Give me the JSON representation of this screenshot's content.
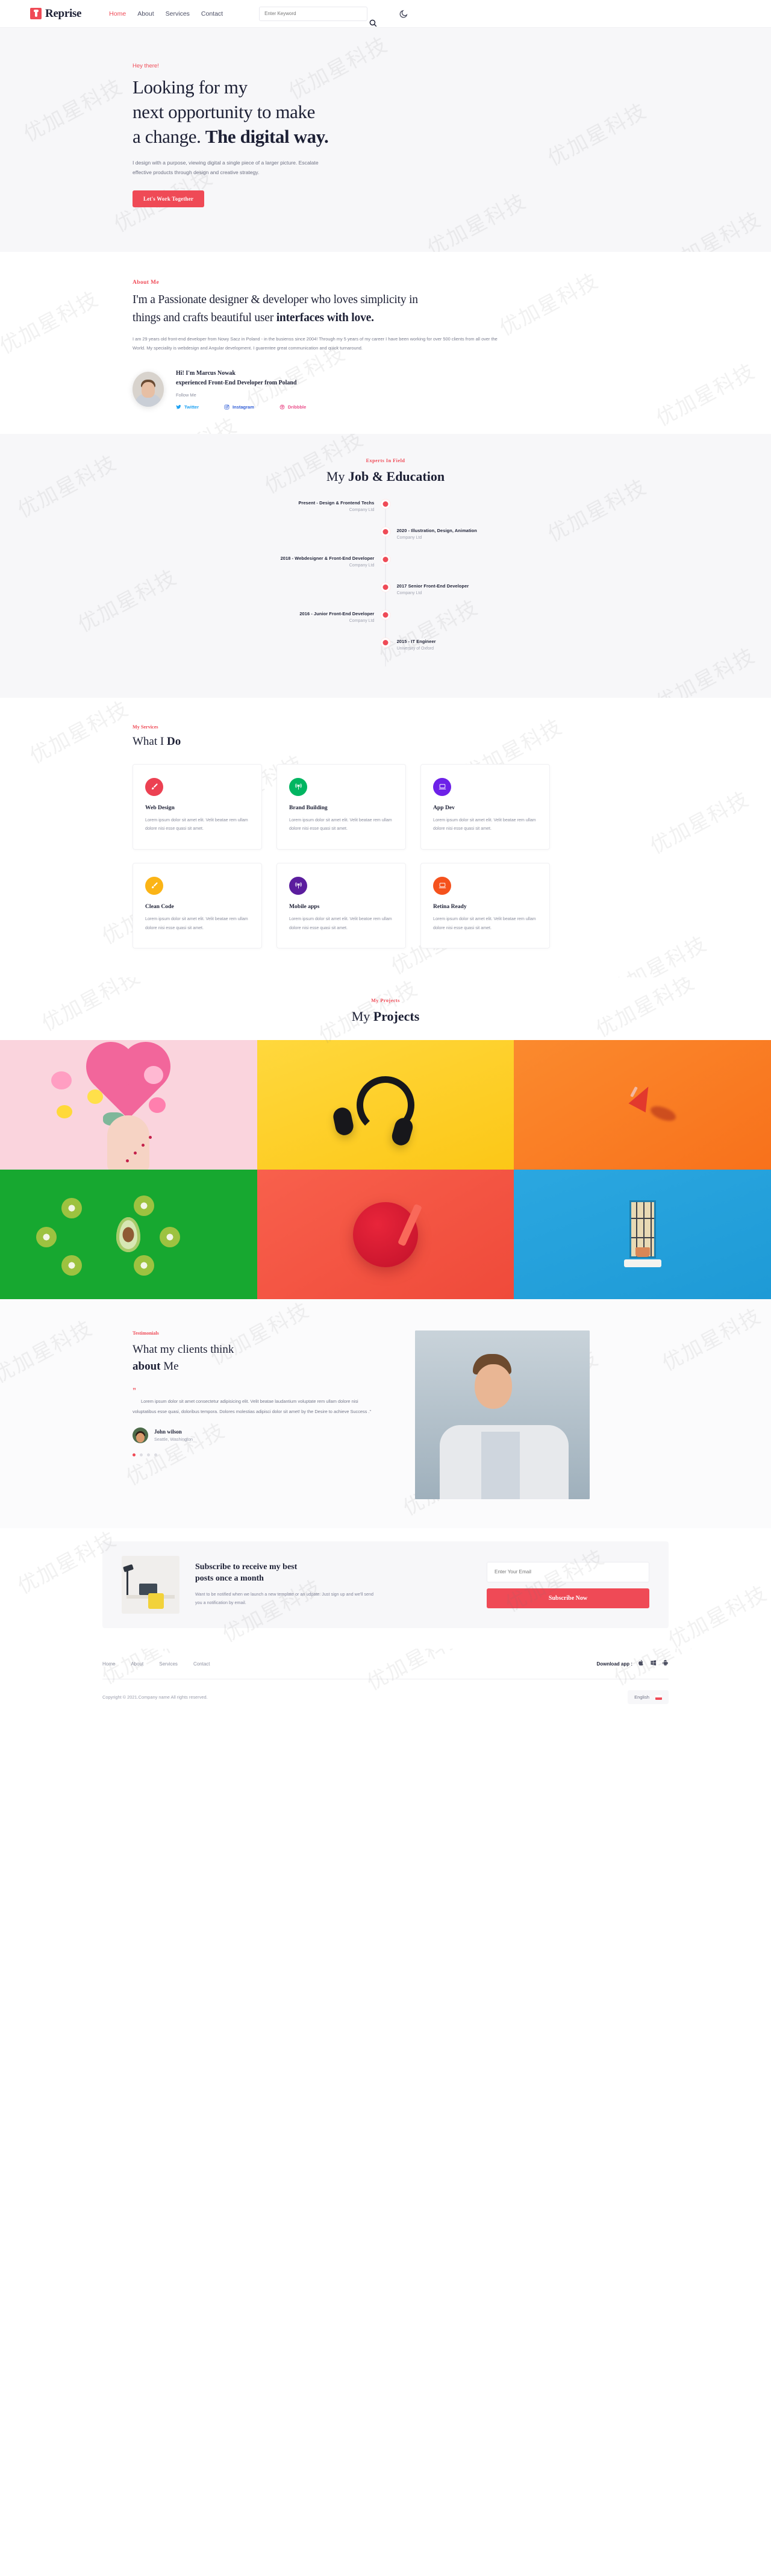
{
  "header": {
    "brand": "Reprise",
    "nav": [
      {
        "label": "Home",
        "active": true
      },
      {
        "label": "About",
        "active": false
      },
      {
        "label": "Services",
        "active": false
      },
      {
        "label": "Contact",
        "active": false
      }
    ],
    "search_placeholder": "Enter Keyword",
    "search_icon": "search-icon",
    "theme_icon": "moon-icon"
  },
  "hero": {
    "eyebrow": "Hey there!",
    "title_line1": "Looking for my",
    "title_line2": "next opportunity to make",
    "title_line3_normal": "a change. ",
    "title_line3_bold": "The digital way.",
    "description": "I design with a purpose, viewing digital a single piece of a larger picture. Escalate effective products through design and creative strategy.",
    "cta_label": "Let's Work Together"
  },
  "about": {
    "eyebrow": "About Me",
    "title_normal": "I'm a Passionate designer & developer who loves simplicity in things and crafts beautiful user ",
    "title_bold": "interfaces with love.",
    "description": "I am 29 years old front-end developer from Nowy Sacz in Poland - in the busienss since 2004! Through my 5 years of my career I have been working for over 500 clients from all over the World. My speciality is webdesign and Angular development. I guarentee great communication and quick turnaround.",
    "person_name_line1": "Hi! I'm Marcus Nowak",
    "person_name_line2": "experienced Front-End Developer from Poland",
    "follow_label": "Follow Me",
    "socials": [
      {
        "label": "Twitter",
        "icon": "twitter-icon",
        "color": "#1da1f2"
      },
      {
        "label": "Instagram",
        "icon": "instagram-icon",
        "color": "#2f5cd6"
      },
      {
        "label": "Dribbble",
        "icon": "dribbble-icon",
        "color": "#ea4c89"
      }
    ]
  },
  "resume": {
    "eyebrow": "Experts In Field",
    "title_normal": "My ",
    "title_bold": "Job & Education",
    "items": [
      {
        "side": "left",
        "role": "Present - Design & Frontend Techs",
        "org": "Company Ltd"
      },
      {
        "side": "right",
        "role": "2020 - Illustration, Design, Animation",
        "org": "Company Ltd"
      },
      {
        "side": "left",
        "role": "2018 - Webdesigner & Front-End Developer",
        "org": "Company Ltd"
      },
      {
        "side": "right",
        "role": "2017 Senior Front-End Developer",
        "org": "Company Ltd"
      },
      {
        "side": "left",
        "role": "2016 - Junior Front-End Developer",
        "org": "Company Ltd"
      },
      {
        "side": "right",
        "role": "2015 - IT Engineer",
        "org": "University of Oxford"
      }
    ]
  },
  "services": {
    "eyebrow": "My Services",
    "title_normal": "What I ",
    "title_bold": "Do",
    "cards": [
      {
        "title": "Web Design",
        "icon": "brush-icon",
        "color": "#ec4152",
        "text": "Lorem ipsum dolor sit amet elit. Velit beatae rem ullam dolore nisi esse quasi sit amet."
      },
      {
        "title": "Brand Building",
        "icon": "broadcast-icon",
        "color": "#00b561",
        "text": "Lorem ipsum dolor sit amet elit. Velit beatae rem ullam dolore nisi esse quasi sit amet."
      },
      {
        "title": "App Dev",
        "icon": "laptop-icon",
        "color": "#6d21e8",
        "text": "Lorem ipsum dolor sit amet elit. Velit beatae rem ullam dolore nisi esse quasi sit amet."
      },
      {
        "title": "Clean Code",
        "icon": "brush-icon",
        "color": "#fbb416",
        "text": "Lorem ipsum dolor sit amet elit. Velit beatae rem ullam dolore nisi esse quasi sit amet."
      },
      {
        "title": "Mobile apps",
        "icon": "broadcast-icon",
        "color": "#5b1d9e",
        "text": "Lorem ipsum dolor sit amet elit. Velit beatoe rem ullam dolore nisi esse quasi sit amet."
      },
      {
        "title": "Retina Ready",
        "icon": "laptop-icon",
        "color": "#f5521d",
        "text": "Lorem ipsum dolor sit amet elit. Velit beatae rem ullam dolore nisi esse quasi sit amet."
      }
    ]
  },
  "projects": {
    "eyebrow": "My Projects",
    "title_normal": "My ",
    "title_bold": "Projects",
    "tiles": [
      {
        "name": "flowers-heart-in-hands",
        "bg": "#fad4dd"
      },
      {
        "name": "black-headphones",
        "bg": "#ffd83d"
      },
      {
        "name": "red-megaphone",
        "bg": "#f8711b"
      },
      {
        "name": "kiwi-avocado-flatlay",
        "bg": "#17a830"
      },
      {
        "name": "red-smoothie-bowl",
        "bg": "#f8604c"
      },
      {
        "name": "blue-wall-window",
        "bg": "#2ba7e0"
      }
    ]
  },
  "testimonials": {
    "eyebrow": "Testimonials",
    "title_line1": "What my clients think",
    "title_bold": "about",
    "title_tail": " Me",
    "quote_mark": "”",
    "quote": "Lorem ipsum dolor sit amet consectetur adipisicing elit. Velit beatae laudantium voluptate rem ullam dolore nisi voluptatibus esse quasi, doloribus tempora. Dolores molestias adipisci dolor sit amet! by the Desire to achieve Success .\"",
    "author_name": "John wilson",
    "author_location": "Seattle, Washington",
    "dots_total": 4,
    "dots_active_index": 0
  },
  "subscribe": {
    "title_line1": "Subscribe to receive my best",
    "title_line2": "posts once a month",
    "description": "Want to be notified when we launch a new template or an udpate. Just sign up and we'll send you a notification by email.",
    "input_placeholder": "Enter Your Email",
    "button_label": "Subscribe Now"
  },
  "footer": {
    "nav": [
      "Home",
      "About",
      "Services",
      "Contact"
    ],
    "download_label": "Download app :",
    "store_icons": [
      "apple-icon",
      "windows-icon",
      "android-icon"
    ],
    "copyright": "Copyright © 2021.Company name All rights reserved.",
    "language": "English",
    "flag_icon": "flag-icon"
  },
  "colors": {
    "accent": "#ef4a56",
    "dark": "#1d2035",
    "muted": "#8b8e9e",
    "bg_light": "#f7f7f9"
  },
  "watermark_text": "优加星科技"
}
